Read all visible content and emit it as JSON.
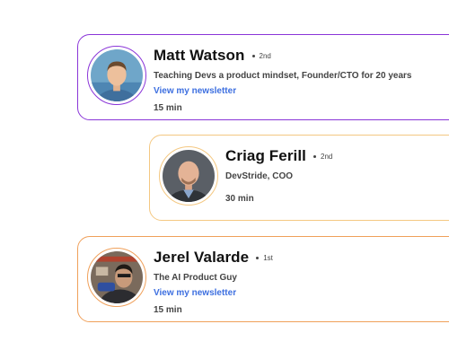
{
  "profiles": [
    {
      "name": "Matt Watson",
      "degree": "2nd",
      "headline": "Teaching Devs a product mindset, Founder/CTO for 20 years",
      "link": "View my newsletter",
      "duration": "15 min",
      "accent": "#8a35d8"
    },
    {
      "name": "Criag Ferill",
      "degree": "2nd",
      "headline": "DevStride, COO",
      "duration": "30 min",
      "accent": "#f4c882"
    },
    {
      "name": "Jerel Valarde",
      "degree": "1st",
      "headline": "The AI Product Guy",
      "link": "View my newsletter",
      "duration": "15 min",
      "accent": "#f0a05a"
    }
  ],
  "colors": {
    "link": "#3d6fe0",
    "text_primary": "#111111",
    "text_secondary": "#444444"
  }
}
